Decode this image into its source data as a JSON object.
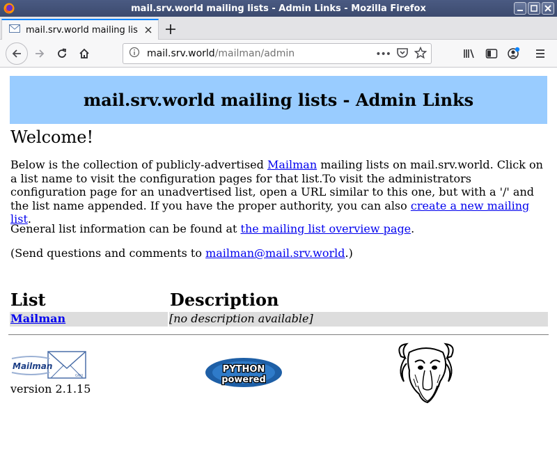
{
  "window": {
    "title": "mail.srv.world mailing lists - Admin Links - Mozilla Firefox"
  },
  "tabs": [
    {
      "label": "mail.srv.world mailing lis"
    }
  ],
  "navbar": {
    "url_host": "mail.srv.world",
    "url_path": "/mailman/admin",
    "page_actions": "•••"
  },
  "page": {
    "banner_title": "mail.srv.world mailing lists - Admin Links",
    "welcome": "Welcome!",
    "intro": {
      "before_link": "Below is the collection of publicly-advertised ",
      "mailman_link": "Mailman",
      "middle": " mailing lists on mail.srv.world. Click on a list name to visit the configuration pages for that list.To visit the administrators configuration page for an unadvertised list, open a URL similar to this one, but with a '/' and the list name appended. If you have the proper authority, you can also ",
      "create_link": "create a new mailing list",
      "end": "."
    },
    "general": {
      "before_link": "General list information can be found at ",
      "overview_link": "the mailing list overview page",
      "end": "."
    },
    "contact": {
      "before_link": "(Send questions and comments to ",
      "email_link": "mailman@mail.srv.world",
      "end": ".)"
    },
    "table": {
      "headers": [
        "List",
        "Description"
      ],
      "rows": [
        {
          "list": "Mailman",
          "description": "[no description available]"
        }
      ]
    },
    "footer": {
      "version": "version 2.1.15",
      "mailman_logo_text": "Mailman",
      "python_logo_text": [
        "PYTHON",
        "powered"
      ]
    }
  },
  "colors": {
    "banner_bg": "#99ccff",
    "row_bg": "#dddddd",
    "link": "#0000ee",
    "tab_accent": "#0a84ff"
  }
}
